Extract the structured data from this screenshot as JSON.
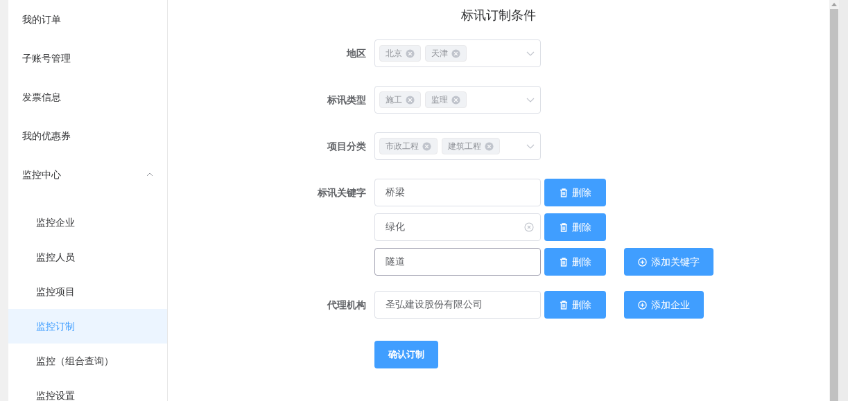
{
  "sidebar": {
    "items": [
      {
        "label": "我的订单",
        "selected": false
      },
      {
        "label": "子账号管理",
        "selected": false
      },
      {
        "label": "发票信息",
        "selected": false
      },
      {
        "label": "我的优惠券",
        "selected": false
      },
      {
        "label": "监控中心",
        "selected": false,
        "expanded": true,
        "children": [
          {
            "label": "监控企业",
            "selected": false
          },
          {
            "label": "监控人员",
            "selected": false
          },
          {
            "label": "监控项目",
            "selected": false
          },
          {
            "label": "监控订制",
            "selected": true
          },
          {
            "label": "监控（组合查询）",
            "selected": false
          },
          {
            "label": "监控设置",
            "selected": false
          }
        ]
      }
    ]
  },
  "form": {
    "title": "标讯订制条件",
    "selects": [
      {
        "label": "地区",
        "tags": [
          "北京",
          "天津"
        ]
      },
      {
        "label": "标讯类型",
        "tags": [
          "施工",
          "监理"
        ]
      },
      {
        "label": "项目分类",
        "tags": [
          "市政工程",
          "建筑工程"
        ]
      }
    ],
    "keywords": {
      "label": "标讯关键字",
      "add_button": "添加关键字",
      "items": [
        {
          "value": "桥梁",
          "hovered": false,
          "focused": false,
          "delete_button": "删除"
        },
        {
          "value": "绿化",
          "hovered": true,
          "focused": false,
          "delete_button": "删除"
        },
        {
          "value": "隧道",
          "hovered": false,
          "focused": true,
          "delete_button": "删除"
        }
      ]
    },
    "agency": {
      "label": "代理机构",
      "value": "圣弘建设股份有限公司",
      "delete_button": "删除",
      "add_button": "添加企业"
    },
    "submit_button": "确认订制"
  }
}
